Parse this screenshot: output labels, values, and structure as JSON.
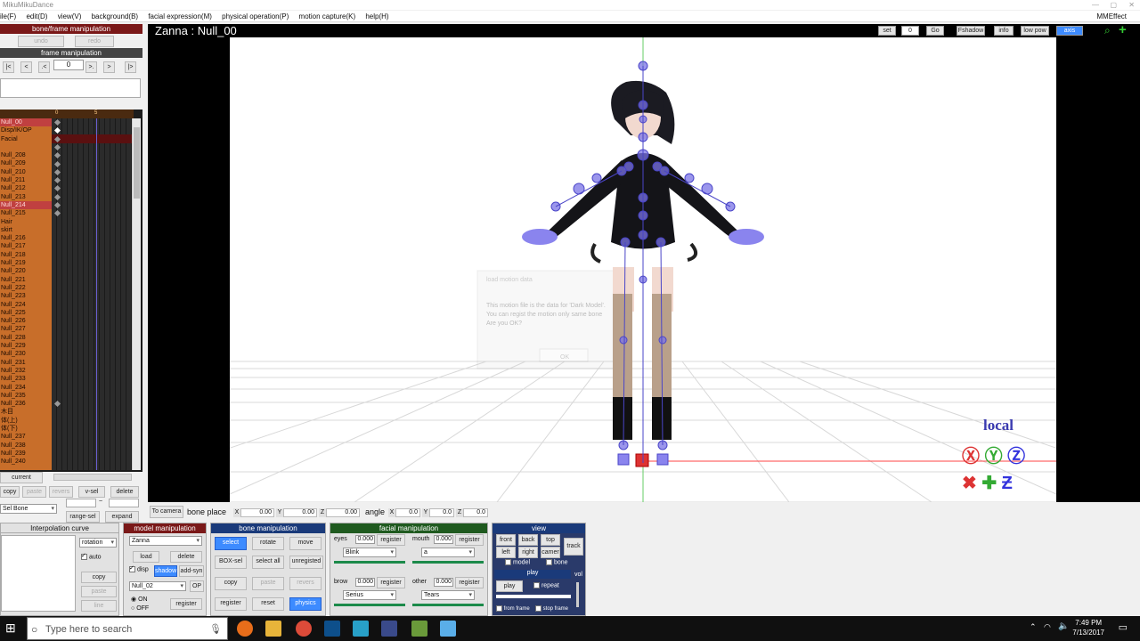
{
  "window": {
    "title": "MikuMikuDance"
  },
  "menu": {
    "items": [
      "ile(F)",
      "edit(D)",
      "view(V)",
      "background(B)",
      "facial expression(M)",
      "physical operation(P)",
      "motion capture(K)",
      "help(H)"
    ],
    "right": "MMEffect"
  },
  "left": {
    "header": "bone/frame manipulation",
    "undo": "undo",
    "redo": "redo",
    "frame_header": "frame manipulation",
    "frame_value": "0",
    "nav": [
      "|<",
      "<",
      ".<",
      ">.",
      ">",
      "|>"
    ],
    "timeline_head": [
      "0",
      "5"
    ],
    "tracks": [
      "Null_00",
      "Disp/IK/OP",
      "Facial",
      "",
      "Null_208",
      "Null_209",
      "Null_210",
      "Null_211",
      "Null_212",
      "Null_213",
      "Null_214",
      "Null_215",
      "Hair",
      "skirt",
      "Null_216",
      "Null_217",
      "Null_218",
      "Null_219",
      "Null_220",
      "Null_221",
      "Null_222",
      "Null_223",
      "Null_224",
      "Null_225",
      "Null_226",
      "Null_227",
      "Null_228",
      "Null_229",
      "Null_230",
      "Null_231",
      "Null_232",
      "Null_233",
      "Null_234",
      "Null_235",
      "Null_236",
      "木目",
      "体(上)",
      "体(下)",
      "Null_237",
      "Null_238",
      "Null_239",
      "Null_240"
    ],
    "highlight": [
      0,
      10
    ],
    "row1": {
      "current": "current"
    },
    "row2": [
      "copy",
      "paste",
      "revers",
      "v-sel",
      "delete"
    ],
    "selbone": "Sel Bone",
    "range_sel": "range-sel",
    "expand": "expand",
    "tilde": "~"
  },
  "viewport": {
    "title": "Zanna : Null_00",
    "set": "set",
    "frame": "0",
    "go": "Go",
    "fshadow": "Fshadow",
    "info": "info",
    "lowpow": "low pow",
    "axis": "axis",
    "local": "local",
    "dialog": {
      "title": "load motion data",
      "line1": "This motion file is the data for 'Dark Model'.",
      "line2": "You can regist the motion only same bone",
      "line3": "Are you OK?",
      "ok": "OK"
    }
  },
  "bonebar": {
    "tocamera": "To camera",
    "boneplace": "bone place",
    "angle": "angle",
    "x": "0.00",
    "y": "0.00",
    "z": "0.00",
    "ax": "0.0",
    "ay": "0.0",
    "az": "0.0"
  },
  "interp": {
    "header": "Interpolation curve",
    "select": "rotation",
    "auto": "auto",
    "copy": "copy",
    "paste": "paste",
    "line": "line"
  },
  "model": {
    "header": "model manipulation",
    "model": "Zanna",
    "load": "load",
    "delete": "delete",
    "disp": "disp",
    "shadow": "shadow",
    "addsyn": "add-syn",
    "bone": "Null_02",
    "op": "OP",
    "on": "ON",
    "off": "OFF",
    "register": "register"
  },
  "bone": {
    "header": "bone manipulation",
    "select": "select",
    "rotate": "rotate",
    "move": "move",
    "boxsel": "BOX-sel",
    "selectall": "select all",
    "unregisted": "unregisted",
    "copy": "copy",
    "paste": "paste",
    "revers": "revers",
    "register": "register",
    "reset": "reset",
    "physics": "physics"
  },
  "facial": {
    "header": "facial manipulation",
    "eyes": {
      "label": "eyes",
      "value": "0.000",
      "register": "register",
      "morph": "Blink"
    },
    "mouth": {
      "label": "mouth",
      "value": "0.000",
      "register": "register",
      "morph": "a"
    },
    "brow": {
      "label": "brow",
      "value": "0.000",
      "register": "register",
      "morph": "Serius"
    },
    "other": {
      "label": "other",
      "value": "0.000",
      "register": "register",
      "morph": "Tears"
    }
  },
  "view": {
    "header": "view",
    "buttons": [
      "front",
      "back",
      "top",
      "left",
      "right",
      "camer"
    ],
    "track": "track",
    "model": "model",
    "bone": "bone",
    "play_header": "play",
    "play": "play",
    "repeat": "repeat",
    "vol": "vol",
    "from_frame": "from frame",
    "stop_frame": "stop frame"
  },
  "taskbar": {
    "search": "Type here to search",
    "time": "7:49 PM",
    "date": "7/13/2017"
  },
  "colors": {
    "accent": "#3d8bff",
    "panel_red": "#7a1818",
    "panel_green": "#1f5a1f",
    "timeline_orange": "#c86e2a"
  }
}
